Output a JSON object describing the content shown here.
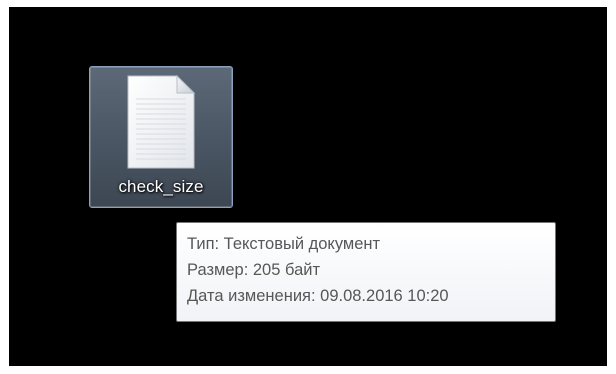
{
  "desktop": {
    "background_color": "#000000",
    "file": {
      "name": "check_size",
      "icon": "text-document-icon",
      "selected": true
    }
  },
  "tooltip": {
    "type_line": "Тип: Текстовый документ",
    "size_line": "Размер: 205 байт",
    "modified_line": "Дата изменения: 09.08.2016 10:20"
  }
}
